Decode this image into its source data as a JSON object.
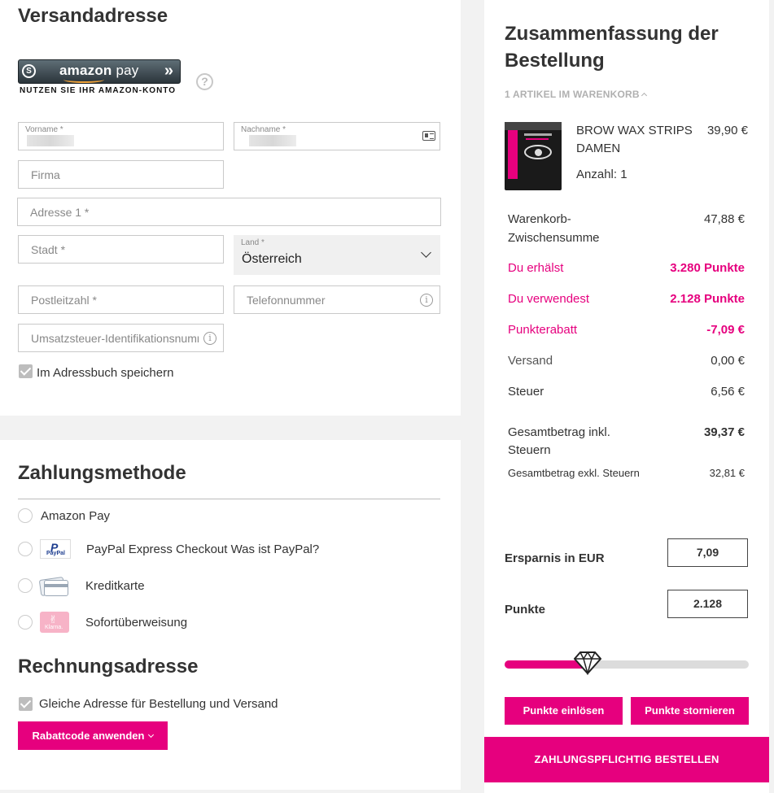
{
  "shipping": {
    "title": "Versandadresse",
    "amazon_pay": {
      "s_badge": "S",
      "logo": "amazon",
      "logo_pay": "pay",
      "sub": "NUTZEN SIE IHR AMAZON-KONTO",
      "help": "?"
    },
    "fields": {
      "vorname_label": "Vorname *",
      "nachname_label": "Nachname *",
      "firma": "Firma",
      "adresse": "Adresse 1 *",
      "stadt": "Stadt *",
      "land_label": "Land *",
      "land_value": "Österreich",
      "plz": "Postleitzahl *",
      "telefon": "Telefonnummer",
      "ustid": "Umsatzsteuer-Identifikationsnummer"
    },
    "info_glyph": "i",
    "save_label": "Im Adressbuch speichern"
  },
  "payment": {
    "title": "Zahlungsmethode",
    "methods": [
      {
        "label": "Amazon Pay"
      },
      {
        "label": "PayPal Express Checkout  Was ist PayPal?"
      },
      {
        "label": "Kreditkarte"
      },
      {
        "label": "Sofortüberweisung"
      }
    ],
    "paypal_logo": "PayPal",
    "klarna_logo": "Klarna."
  },
  "billing": {
    "title": "Rechnungsadresse",
    "same_address": "Gleiche Adresse für Bestellung und Versand",
    "coupon_button": "Rabattcode anwenden"
  },
  "summary": {
    "title_line1": "Zusammenfassung der",
    "title_line2": "Bestellung",
    "items_toggle": "1 ARTIKEL IM WARENKORB",
    "product": {
      "name_line1": "BROW WAX STRIPS",
      "name_line2": "DAMEN",
      "price": "39,90 €",
      "qty": "Anzahl: 1"
    },
    "rows": {
      "subtotal_label_1": "Warenkorb-",
      "subtotal_label_2": "Zwischensumme",
      "subtotal_value": "47,88 €",
      "earn_label": "Du erhälst",
      "earn_value": "3.280 Punkte",
      "use_label": "Du verwendest",
      "use_value": "2.128 Punkte",
      "discount_label": "Punkterabatt",
      "discount_value": "-7,09 €",
      "shipping_label": "Versand",
      "shipping_value": "0,00 €",
      "tax_label": "Steuer",
      "tax_value": "6,56 €",
      "total_label_1": "Gesamtbetrag inkl.",
      "total_label_2": "Steuern",
      "total_value": "39,37 €",
      "net_label": "Gesamtbetrag exkl. Steuern",
      "net_value": "32,81 €"
    },
    "savings_label": "Ersparnis in EUR",
    "savings_value": "7,09",
    "points_label": "Punkte",
    "points_value": "2.128",
    "slider_level": 0.34,
    "redeem_button": "Punkte einlösen",
    "cancel_button": "Punkte stornieren",
    "order_button": "ZAHLUNGSPFLICHTIG BESTELLEN"
  },
  "colors": {
    "accent": "#e6007e",
    "muted": "#b0b0b0"
  }
}
